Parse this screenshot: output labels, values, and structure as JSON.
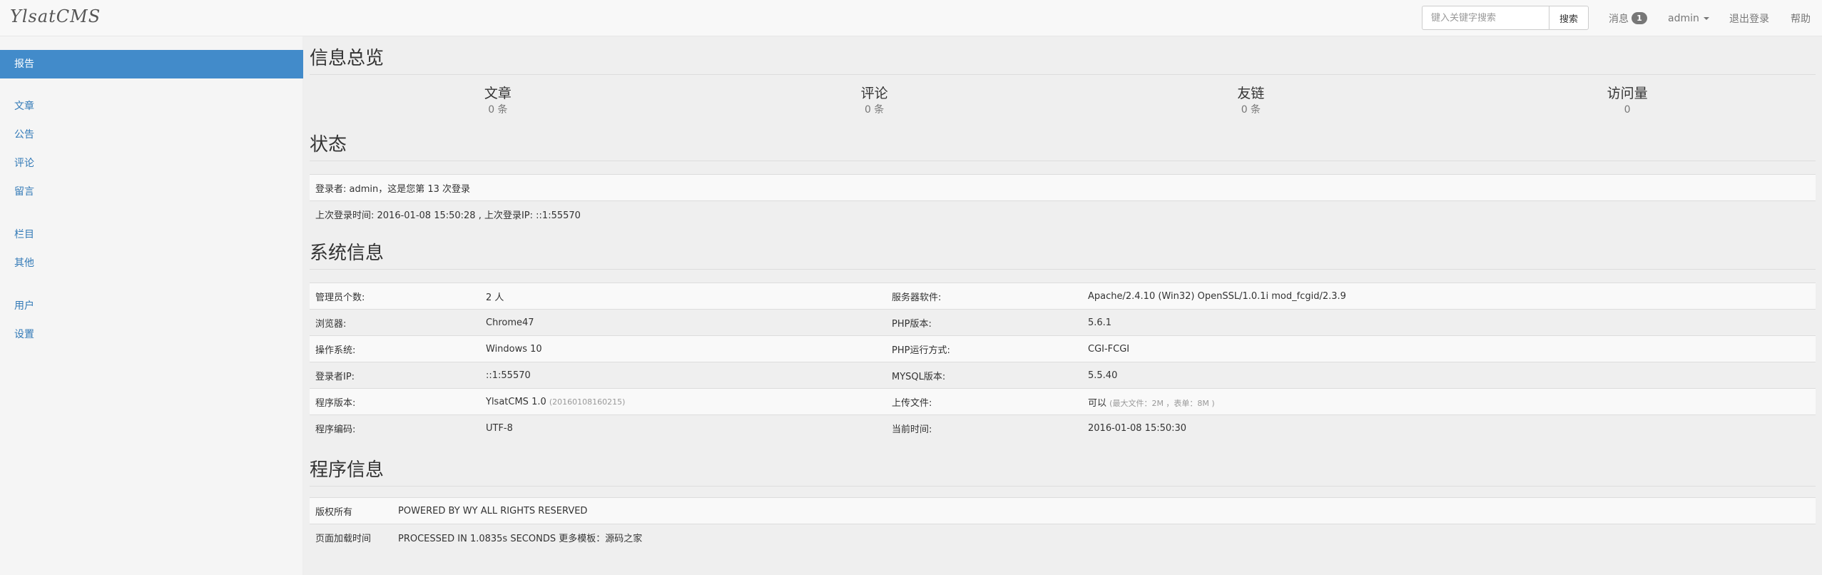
{
  "navbar": {
    "brand": "YlsatCMS",
    "search": {
      "placeholder": "键入关键字搜索",
      "button_label": "搜索"
    },
    "messages": {
      "label": "消息",
      "count": "1"
    },
    "user": {
      "label": "admin"
    },
    "logout_label": "退出登录",
    "help_label": "帮助"
  },
  "sidebar": {
    "items": [
      {
        "label": "报告"
      },
      {
        "label": "文章"
      },
      {
        "label": "公告"
      },
      {
        "label": "评论"
      },
      {
        "label": "留言"
      },
      {
        "label": "栏目"
      },
      {
        "label": "其他"
      },
      {
        "label": "用户"
      },
      {
        "label": "设置"
      }
    ],
    "active_index": 0
  },
  "overview": {
    "title": "信息总览",
    "items": [
      {
        "label": "文章",
        "value": "0 条"
      },
      {
        "label": "评论",
        "value": "0 条"
      },
      {
        "label": "友链",
        "value": "0 条"
      },
      {
        "label": "访问量",
        "value": "0"
      }
    ]
  },
  "status": {
    "title": "状态",
    "rows": [
      "登录者: admin，这是您第 13 次登录",
      "上次登录时间: 2016-01-08 15:50:28 , 上次登录IP: ::1:55570"
    ]
  },
  "system": {
    "title": "系统信息",
    "rows": [
      {
        "k1": "管理员个数:",
        "v1": "2 人",
        "v1_note": "",
        "k2": "服务器软件:",
        "v2": "Apache/2.4.10 (Win32) OpenSSL/1.0.1i mod_fcgid/2.3.9",
        "v2_note": ""
      },
      {
        "k1": "浏览器:",
        "v1": "Chrome47",
        "v1_note": "",
        "k2": "PHP版本:",
        "v2": "5.6.1",
        "v2_note": ""
      },
      {
        "k1": "操作系统:",
        "v1": "Windows 10",
        "v1_note": "",
        "k2": "PHP运行方式:",
        "v2": "CGI-FCGI",
        "v2_note": ""
      },
      {
        "k1": "登录者IP:",
        "v1": "::1:55570",
        "v1_note": "",
        "k2": "MYSQL版本:",
        "v2": "5.5.40",
        "v2_note": ""
      },
      {
        "k1": "程序版本:",
        "v1": "YlsatCMS 1.0",
        "v1_note": "(20160108160215)",
        "k2": "上传文件:",
        "v2": "可以",
        "v2_note": "(最大文件：2M ，表单：8M )"
      },
      {
        "k1": "程序编码:",
        "v1": "UTF-8",
        "v1_note": "",
        "k2": "当前时间:",
        "v2": "2016-01-08 15:50:30",
        "v2_note": ""
      }
    ]
  },
  "program": {
    "title": "程序信息",
    "rows": [
      {
        "key": "版权所有",
        "value": "POWERED BY WY ALL RIGHTS RESERVED"
      },
      {
        "key": "页面加载时间",
        "value": "PROCESSED IN 1.0835s SECONDS 更多模板：源码之家"
      }
    ]
  },
  "colors": {
    "accent": "#428bca",
    "link": "#337ab7",
    "page_bg": "#efefef",
    "navbar_bg": "#f8f8f8"
  }
}
